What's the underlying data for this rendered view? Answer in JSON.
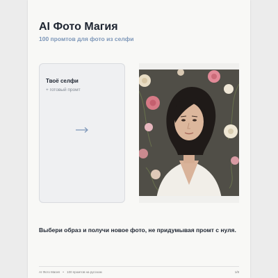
{
  "header": {
    "title": "AI Фото Магия",
    "subtitle": "100 промтов для фото из селфи"
  },
  "selfie_card": {
    "title": "Твоё селфи",
    "subtitle": "+ готовый промт",
    "arrow_icon": "arrow-right-icon"
  },
  "photo": {
    "icon": "portrait-photo"
  },
  "caption": "Выбери образ и получи новое фото, не придумывая промт с нуля.",
  "footer": {
    "brand": "AI Фото Магия",
    "separator": "•",
    "tagline": "100 промтов на русском",
    "page_indicator": "1/8"
  },
  "colors": {
    "title": "#1d2430",
    "subtitle_accent": "#7c96b8",
    "arrow": "#7c96b8",
    "card_bg": "#eff0f2",
    "photo_bg": "#4c4a44"
  }
}
